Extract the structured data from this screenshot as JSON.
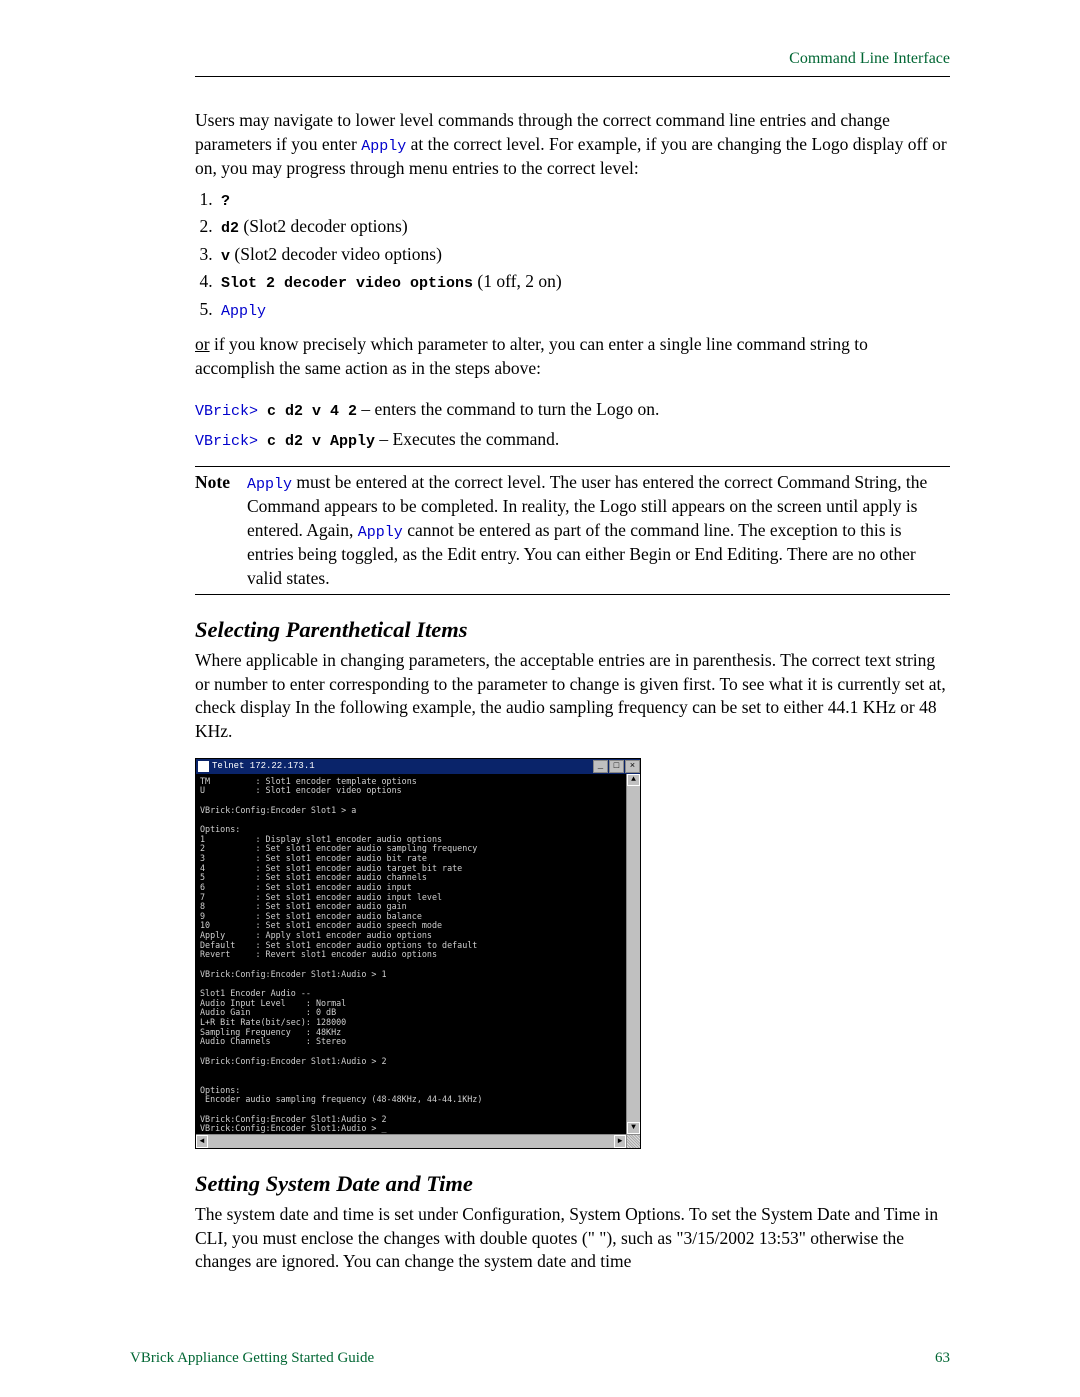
{
  "header": {
    "right": "Command Line Interface"
  },
  "intro": {
    "p1a": "Users may navigate to lower level commands through the correct command line entries and change parameters if you enter ",
    "p1apply": "Apply",
    "p1b": " at the correct level. For example, if you are changing the Logo display off or on, you may progress through menu entries to the correct level:"
  },
  "steps": {
    "s1_cmd": "?",
    "s2_cmd": "d2",
    "s2_desc": " (Slot2 decoder options)",
    "s3_cmd": "v",
    "s3_desc": " (Slot2 decoder video options)",
    "s4_cmd": "Slot 2 decoder video options",
    "s4_desc": " (1 off, 2 on)",
    "s5_cmd": "Apply"
  },
  "alt": {
    "pre": "or",
    "rest": " if you know precisely which parameter to alter, you can enter a single line command string to accomplish the same action as in the steps above:"
  },
  "cmd_lines": {
    "prompt": "VBrick>",
    "c1": " c d2 v 4 2",
    "c1desc": " – enters the command to turn the Logo on.",
    "c2": " c d2 v Apply",
    "c2desc": " – Executes the command."
  },
  "note": {
    "label": "Note",
    "t1": "Apply",
    "t2": " must be entered at the correct level. The user has entered the correct Command String, the Command appears to be completed. In reality, the Logo still appears on the screen until apply is entered. Again, ",
    "t3": "Apply",
    "t4": " cannot be entered as part of the command line. The exception to this is entries being toggled, as the Edit entry. You can either Begin or End Editing. There are no other valid states."
  },
  "sec1": {
    "title": "Selecting Parenthetical Items",
    "body": "Where applicable in changing parameters, the acceptable entries are in parenthesis. The correct text string or number to enter corresponding to the parameter to change is given first. To see what it is currently set at, check display In the following example, the audio sampling frequency can be set to either 44.1 KHz or 48 KHz."
  },
  "terminal": {
    "title": "Telnet 172.22.173.1",
    "content": "TM         : Slot1 encoder template options\nU          : Slot1 encoder video options\n\nVBrick:Config:Encoder Slot1 > a\n\nOptions:\n1          : Display slot1 encoder audio options\n2          : Set slot1 encoder audio sampling frequency\n3          : Set slot1 encoder audio bit rate\n4          : Set slot1 encoder audio target bit rate\n5          : Set slot1 encoder audio channels\n6          : Set slot1 encoder audio input\n7          : Set slot1 encoder audio input level\n8          : Set slot1 encoder audio gain\n9          : Set slot1 encoder audio balance\n10         : Set slot1 encoder audio speech mode\nApply      : Apply slot1 encoder audio options\nDefault    : Set slot1 encoder audio options to default\nRevert     : Revert slot1 encoder audio options\n\nVBrick:Config:Encoder Slot1:Audio > 1\n\nSlot1 Encoder Audio --\nAudio Input Level    : Normal\nAudio Gain           : 0 dB\nL+R Bit Rate(bit/sec): 128000\nSampling Frequency   : 48KHz\nAudio Channels       : Stereo\n\nVBrick:Config:Encoder Slot1:Audio > 2\n\n\nOptions:\n Encoder audio sampling frequency (48-48KHz, 44-44.1KHz)\n\nVBrick:Config:Encoder Slot1:Audio > 2\nVBrick:Config:Encoder Slot1:Audio > _"
  },
  "sec2": {
    "title": "Setting System Date and Time",
    "body": "The system date and time is set under Configuration, System Options. To set the System Date and Time in CLI, you must enclose the changes with double quotes (\" \"), such as \"3/15/2002 13:53\" otherwise the changes are ignored. You can change the system date and time"
  },
  "footer": {
    "left": "VBrick Appliance Getting Started Guide",
    "right": "63"
  }
}
